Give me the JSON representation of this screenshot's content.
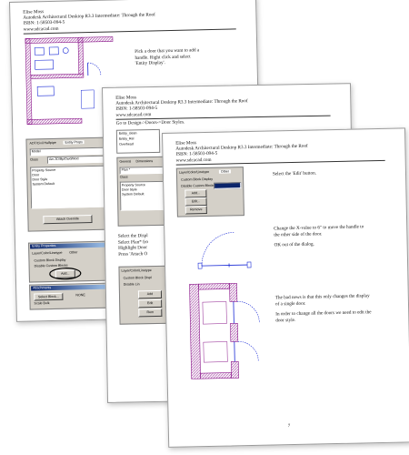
{
  "header": {
    "author": "Elise Moss",
    "title": "Autodesk Architectural Desktop R3.3 Intermediate: Through the Roof",
    "isbn": "ISBN: 1-58503-094-5",
    "url": "www.sdcacad.com"
  },
  "page1": {
    "instruction": [
      "Pick a door that you want to add a",
      "handle.  Right click and select",
      "'Entity Display'."
    ],
    "tabs": [
      "ADT/Civil Halfpipe",
      "Entity Props"
    ],
    "dialog_label1": "Model",
    "dialog_label2": "Class",
    "dialog_value2": "Am.3D/Bp/Dwd/Mod",
    "list_items": [
      "Property Source",
      "Door",
      "Door Style",
      "System Default"
    ],
    "attach_button": "Attach Override",
    "panel_title": "Entity Properties",
    "panel_tabs": [
      "Layer/Color/Linetype",
      "Other"
    ],
    "panel_group": "Custom Block Display",
    "panel_checkbox": "Disable Custom Blocks",
    "panel_add": "Add...",
    "bottom_title": "Attachments",
    "bottom_btn": "Select Block...",
    "bottom_label1": "NONE",
    "bottom_label2": "Scale Bulk"
  },
  "page2": {
    "instruction": "Go to Design->Doors->Door Styles.",
    "menu_items": [
      "Entity_clean",
      "Entity_Rel",
      "Overhead"
    ],
    "tab_labels": [
      "General",
      "Dimensions"
    ],
    "field_label": "Plan *",
    "class_label": "Class",
    "list_items": [
      "Property Source",
      "Door Style",
      "System Default"
    ],
    "body_lines": [
      "Select the Displ",
      "Select Plan* fro",
      "Highlight Door",
      "Press 'Attach O"
    ],
    "panel_tab": "Layer/Color/Linetype",
    "panel_group": "Custom Block Displ",
    "panel_check": "Disable Lin",
    "buttons": [
      "Add",
      "Edit",
      "Rem"
    ]
  },
  "page3": {
    "dialog_tabs": [
      "Layer/Color/Linetype",
      "Other"
    ],
    "dialog_group": "Custom Block Display",
    "dialog_check": "Disable Custom Blocks",
    "dialog_buttons": [
      "Add...",
      "Edit...",
      "Remove"
    ],
    "select_text": "Select the 'Edit' button.",
    "change_text": [
      "Change the X-value to 6\" to move the handle to",
      "the other side of the door."
    ],
    "ok_text": "OK out of the dialog.",
    "bad_news": [
      "The bad news is that this only changes the display",
      "of a single door."
    ],
    "in_order": [
      "In order to change all the doors we need to edit the",
      "door style."
    ],
    "page_number": "7"
  },
  "colors": {
    "wall_hatch": "#8c1a8c",
    "door_line": "#1a2bd6",
    "dialog_gray": "#d4d0c8",
    "title_blue": "#0a246a"
  }
}
